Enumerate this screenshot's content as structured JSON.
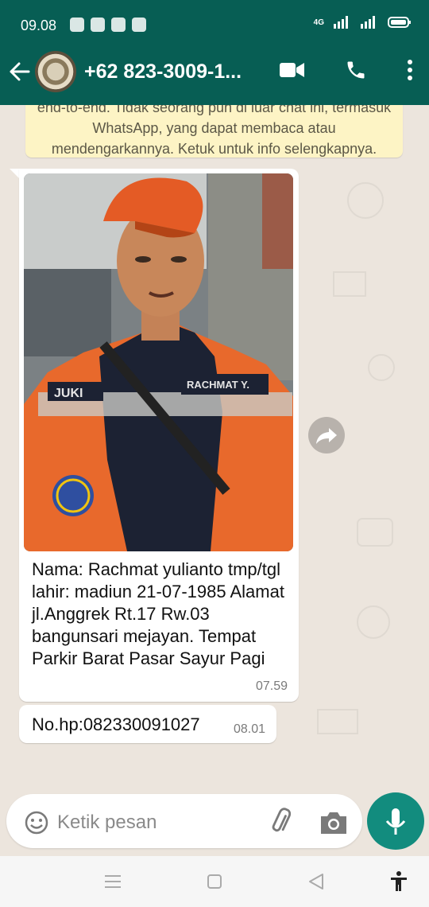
{
  "statusbar": {
    "time": "09.08",
    "network": "4G"
  },
  "header": {
    "contact": "+62 823-3009-1..."
  },
  "notice": {
    "text": "end-to-end. Tidak seorang pun di luar chat ini, termasuk WhatsApp, yang dapat membaca atau mendengarkannya. Ketuk untuk info selengkapnya."
  },
  "messages": [
    {
      "caption": "Nama: Rachmat yulianto tmp/tgl lahir: madiun 21-07-1985 Alamat jl.Anggrek Rt.17 Rw.03 bangunsari mejayan. Tempat Parkir Barat Pasar Sayur Pagi",
      "time": "07.59",
      "photo_patch_texts": [
        "JUKI",
        "RACHMAT Y."
      ]
    },
    {
      "text": "No.hp:082330091027",
      "time": "08.01"
    }
  ],
  "composer": {
    "placeholder": "Ketik pesan"
  },
  "colors": {
    "header": "#075e54",
    "accent": "#128c7e",
    "chat_bg": "#ece5dd",
    "notice_bg": "#fdf4c5"
  }
}
